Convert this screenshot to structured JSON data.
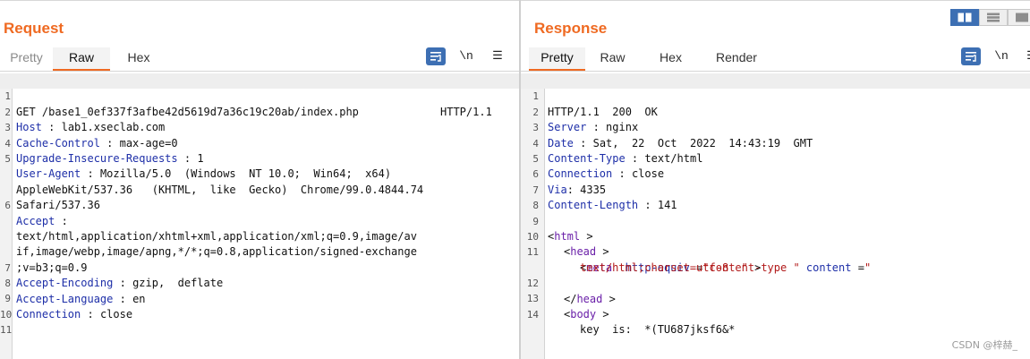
{
  "request": {
    "title": "Request",
    "tabs": [
      {
        "label": "Pretty",
        "active": false
      },
      {
        "label": "Raw",
        "active": true
      },
      {
        "label": "Hex",
        "active": false
      }
    ],
    "tools": {
      "newline": "\\n",
      "menu": "☰"
    },
    "lines": [
      {
        "num": "1",
        "url": "GET /base1_0ef337f3afbe42d5619d7a36c19c20ab/index.php",
        "proto": "HTTP/1.1"
      },
      {
        "num": "2",
        "name": "Host",
        "sep": " : ",
        "value": "lab1.xseclab.com"
      },
      {
        "num": "3",
        "name": "Cache-Control",
        "sep": " : ",
        "value": "max-age=0"
      },
      {
        "num": "4",
        "name": "Upgrade-Insecure-Requests",
        "sep": " : ",
        "value": "1"
      },
      {
        "num": "5",
        "name": "User-Agent",
        "sep": " : ",
        "value": "Mozilla/5.0  (Windows  NT 10.0;  Win64;  x64)"
      },
      {
        "num": "",
        "text": "AppleWebKit/537.36   (KHTML,  like  Gecko)  Chrome/99.0.4844.74"
      },
      {
        "num": "",
        "text": "Safari/537.36"
      },
      {
        "num": "6",
        "name": "Accept",
        "sep": " :",
        "value": ""
      },
      {
        "num": "",
        "text": "text/html,application/xhtml+xml,application/xml;q=0.9,image/av"
      },
      {
        "num": "",
        "text": "if,image/webp,image/apng,*/*;q=0.8,application/signed-exchange"
      },
      {
        "num": "",
        "text": ";v=b3;q=0.9"
      },
      {
        "num": "7",
        "name": "Accept-Encoding",
        "sep": " : ",
        "value": "gzip,  deflate"
      },
      {
        "num": "8",
        "name": "Accept-Language",
        "sep": " : ",
        "value": "en"
      },
      {
        "num": "9",
        "name": "Connection",
        "sep": " : ",
        "value": "close"
      },
      {
        "num": "10",
        "text": ""
      },
      {
        "num": "11",
        "text": ""
      }
    ]
  },
  "response": {
    "title": "Response",
    "tabs": [
      {
        "label": "Pretty",
        "active": true
      },
      {
        "label": "Raw",
        "active": false
      },
      {
        "label": "Hex",
        "active": false
      },
      {
        "label": "Render",
        "active": false
      }
    ],
    "tools": {
      "newline": "\\n",
      "menu": "☰"
    },
    "lines": {
      "l1": {
        "num": "1",
        "text": "HTTP/1.1  200  OK"
      },
      "l2": {
        "num": "2",
        "name": "Server",
        "sep": " : ",
        "value": "nginx"
      },
      "l3": {
        "num": "3",
        "name": "Date",
        "sep": " : ",
        "value": "Sat,  22  Oct  2022  14:43:19  GMT"
      },
      "l4": {
        "num": "4",
        "name": "Content-Type",
        "sep": " : ",
        "value": "text/html"
      },
      "l5": {
        "num": "5",
        "name": "Connection",
        "sep": " : ",
        "value": "close"
      },
      "l6": {
        "num": "6",
        "name": "Via",
        "sep": ": ",
        "value": "4335"
      },
      "l7": {
        "num": "7",
        "name": "Content-Length",
        "sep": " : ",
        "value": "141"
      },
      "l8": {
        "num": "8"
      },
      "l9": {
        "num": "9",
        "open": "<",
        "tag": "html",
        "close": " >"
      },
      "l10": {
        "num": "10",
        "open": "<",
        "tag": "head",
        "close": " >"
      },
      "l11": {
        "num": "11",
        "open": "<",
        "tag": "meta",
        "attr1": "http-equiv",
        "eq1": " =",
        "val1": "\"content-type \"",
        "attr2": "content",
        "eq2": " =",
        "val2a": "\""
      },
      "l11b": {
        "val2b": "text/html;charset=utf-8  \"",
        "close": " >"
      },
      "l12": {
        "num": "12",
        "open": "</",
        "tag": "head",
        "close": " >"
      },
      "l13": {
        "num": "13",
        "open": "<",
        "tag": "body",
        "close": " >"
      },
      "l14": {
        "num": "14",
        "text": "key  is:  *(TU687jksf6&*"
      }
    }
  },
  "watermark": "CSDN @梓赫_",
  "colors": {
    "accent": "#ef6a22",
    "pretty_button": "#3d6fb3",
    "header_name": "#1e2fa8",
    "tag": "#6a1fa8",
    "attr_value": "#b11818"
  }
}
